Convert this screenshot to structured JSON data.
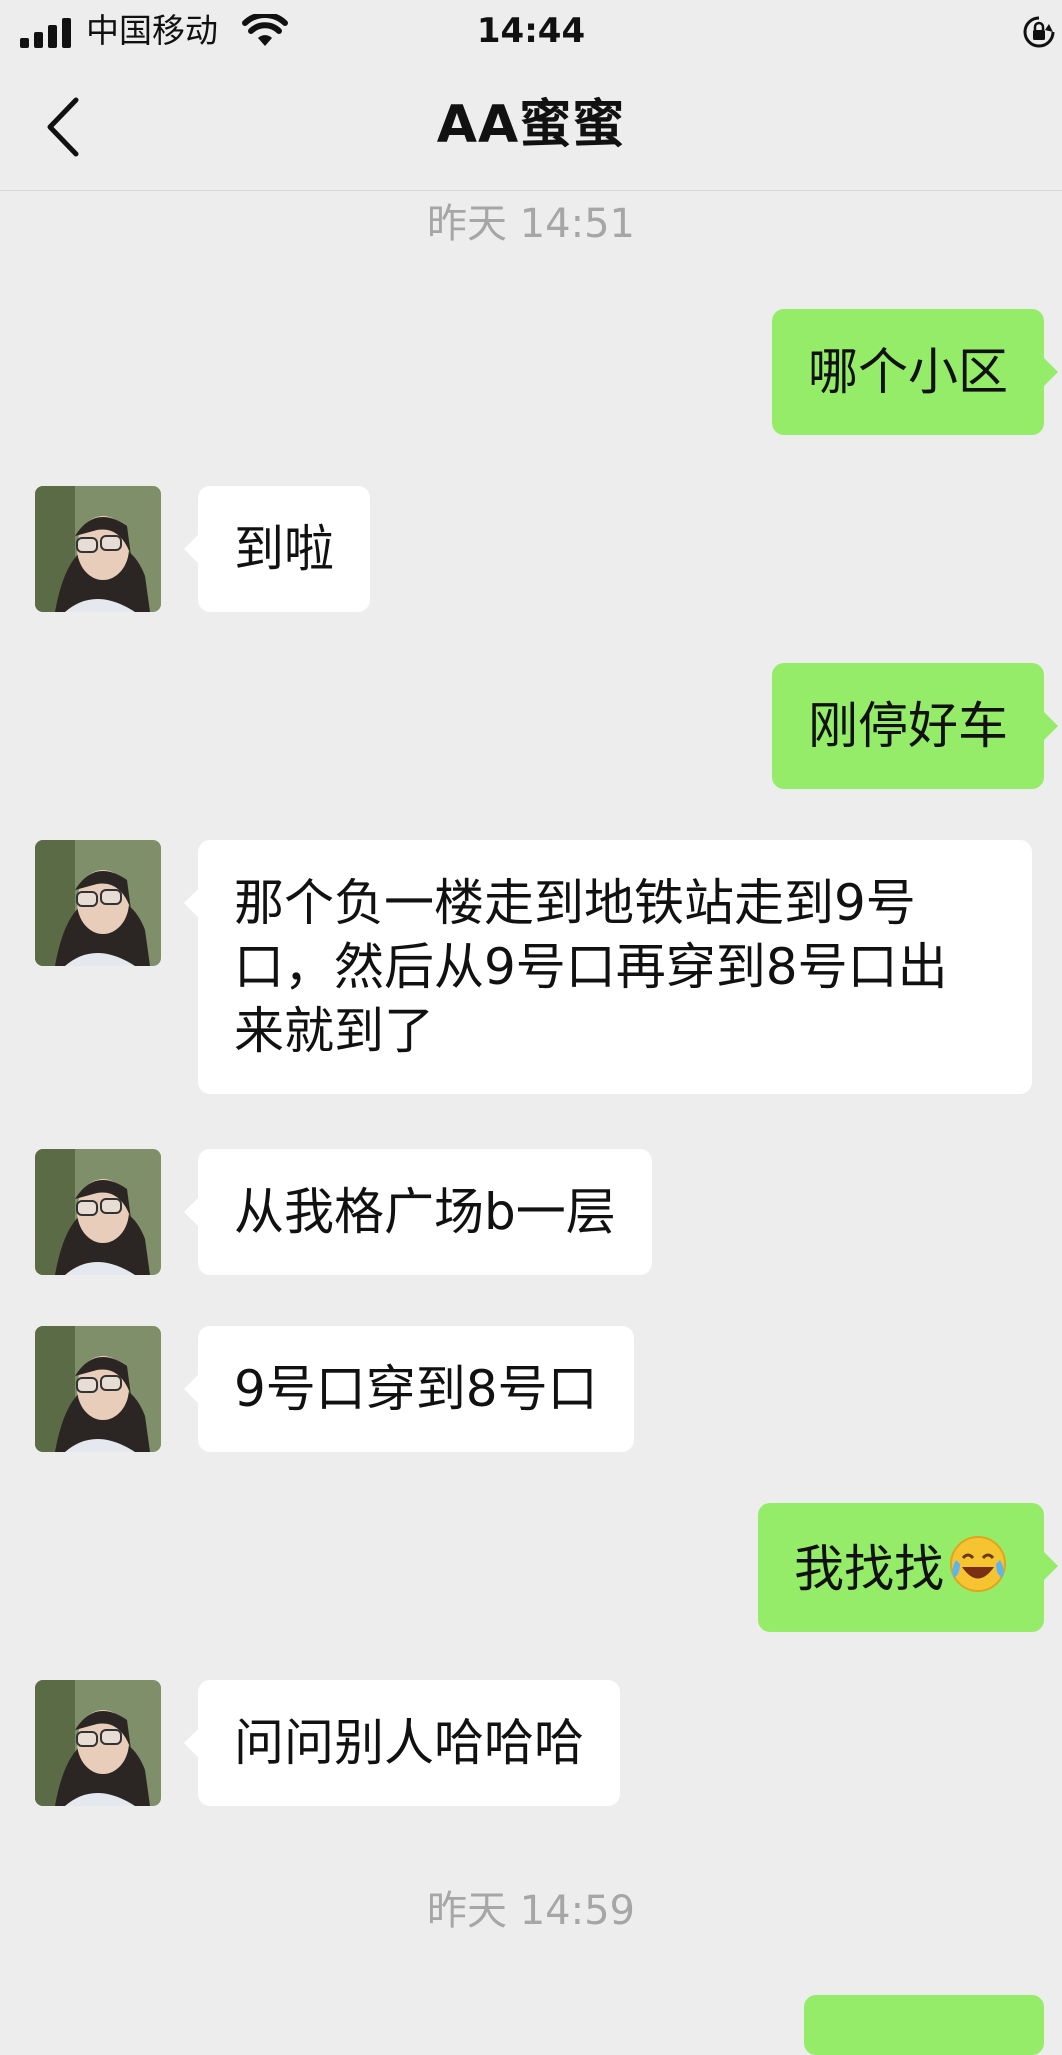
{
  "status_bar": {
    "carrier": "中国移动",
    "time": "14:44",
    "icons": [
      "signal-icon",
      "wifi-icon",
      "rotation-lock-icon"
    ]
  },
  "nav": {
    "title": "AA蜜蜜",
    "back_icon": "chevron-left-icon"
  },
  "colors": {
    "background": "#ededed",
    "sent_bubble": "#95ec69",
    "received_bubble": "#ffffff",
    "timestamp": "#a6a6a6"
  },
  "timestamps": [
    "昨天 14:51",
    "昨天 14:59"
  ],
  "messages": [
    {
      "from": "me",
      "text": "哪个小区"
    },
    {
      "from": "friend",
      "text": "到啦"
    },
    {
      "from": "me",
      "text": "刚停好车"
    },
    {
      "from": "friend",
      "text": "那个负一楼走到地铁站走到9号口，然后从9号口再穿到8号口出来就到了"
    },
    {
      "from": "friend",
      "text": "从我格广场b一层"
    },
    {
      "from": "friend",
      "text": "9号口穿到8号口"
    },
    {
      "from": "me",
      "text": "我找找",
      "emoji": "laughing-crying-emoji"
    },
    {
      "from": "friend",
      "text": "问问别人哈哈哈"
    }
  ]
}
